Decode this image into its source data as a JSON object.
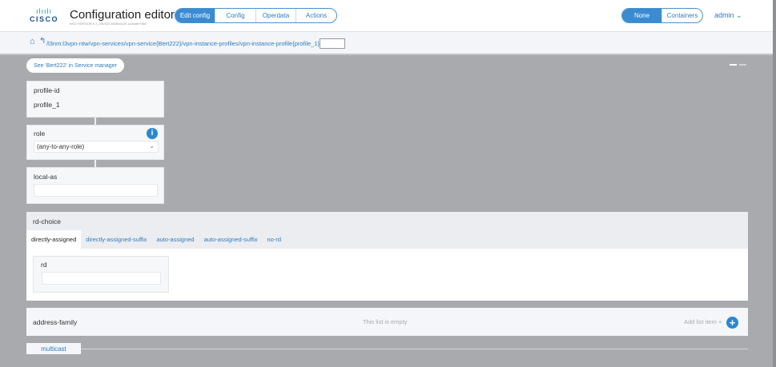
{
  "header": {
    "logo": "cisco",
    "title": "Configuration editor",
    "version": "NSO VERSION 6.1_230322.150844420.1cdcafef7fdd",
    "modes": [
      "Edit config",
      "Config",
      "Operdata",
      "Actions"
    ],
    "active_mode": "Edit config",
    "views": [
      "None",
      "Containers"
    ],
    "active_view": "None",
    "user": "admin"
  },
  "pathbar": {
    "path": "/l3nm:l3vpn-ntw/vpn-services/vpn-service{Bert222}/vpn-instance-profiles/vpn-instance-profile{profile_1}/",
    "input_value": ""
  },
  "service_button": "See 'Bert222' in Service manager",
  "fields": {
    "profile_id": {
      "label": "profile-id",
      "value": "profile_1"
    },
    "role": {
      "label": "role",
      "value": "(any-to-any-role)"
    },
    "local_as": {
      "label": "local-as",
      "value": ""
    }
  },
  "rd_choice": {
    "label": "rd-choice",
    "tabs": [
      "directly-assigned",
      "directly-assigned-suffix",
      "auto-assigned",
      "auto-assigned-suffix",
      "no-rd"
    ],
    "active_tab": "directly-assigned",
    "rd_label": "rd",
    "rd_value": ""
  },
  "address_family": {
    "label": "address-family",
    "empty_text": "This list is empty",
    "add_label": "Add list item +"
  },
  "multicast": {
    "label": "multicast"
  }
}
